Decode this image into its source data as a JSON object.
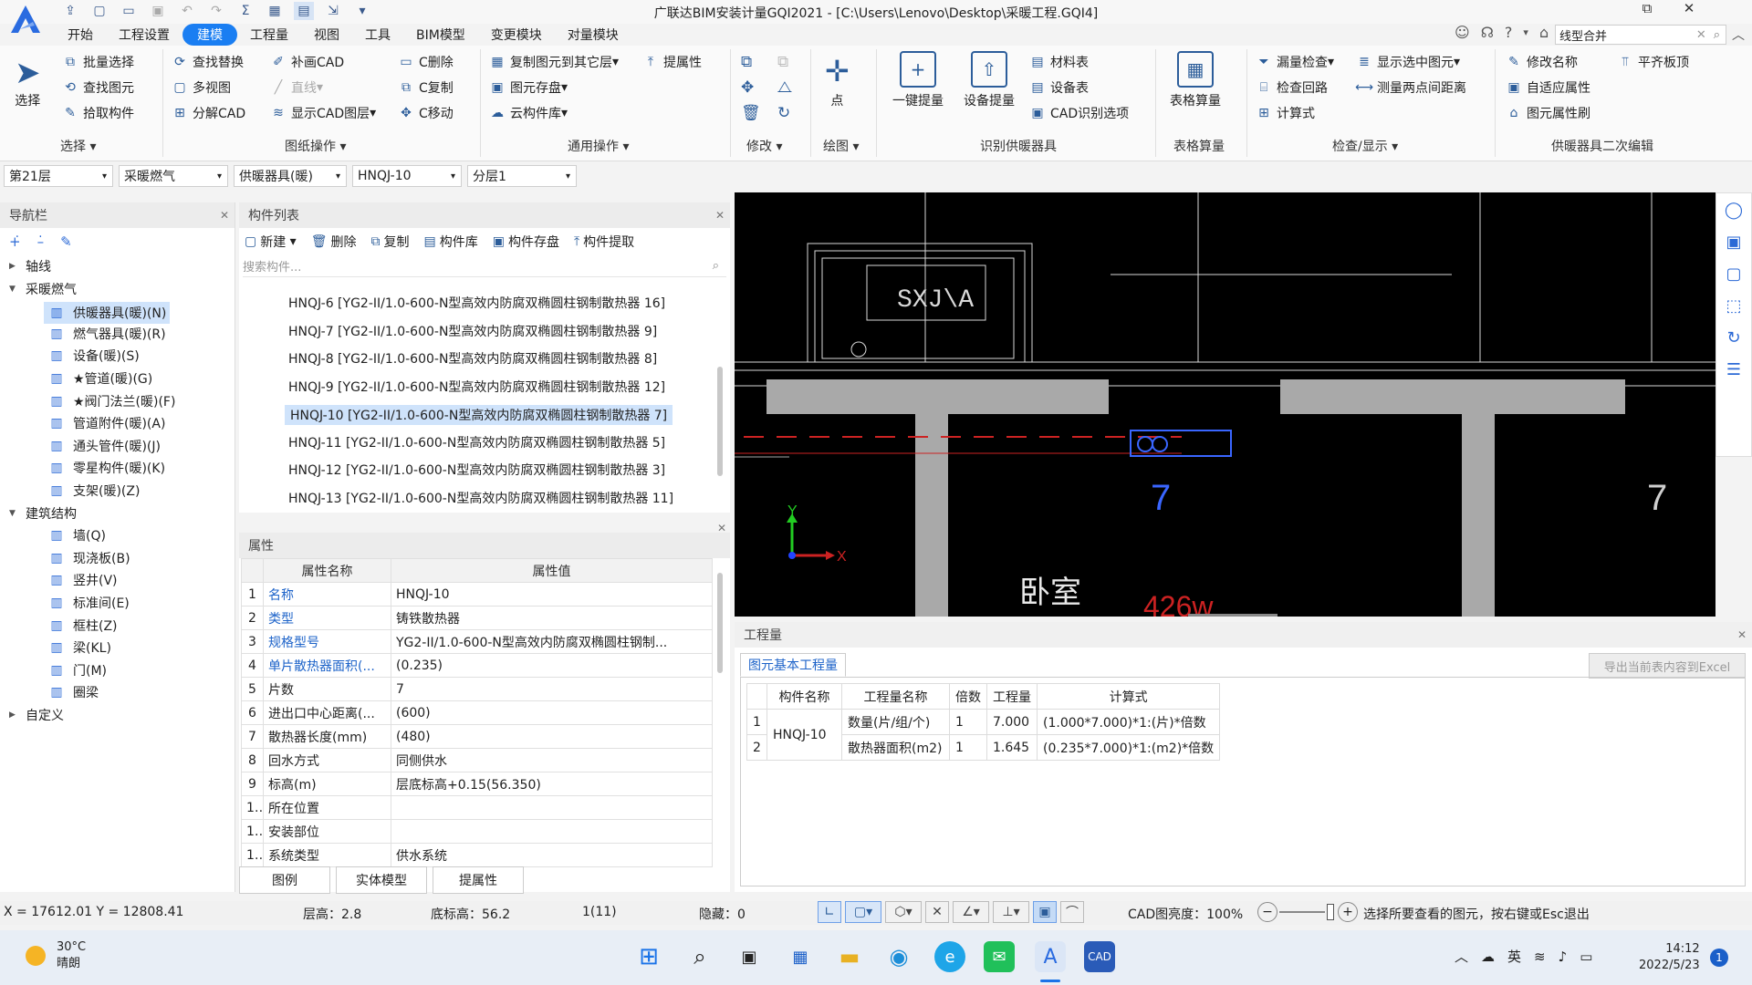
{
  "window": {
    "title": "广联达BIM安装计量GQI2021 - [C:\\Users\\Lenovo\\Desktop\\采暖工程.GQI4]",
    "search_value": "线型合并"
  },
  "menu": [
    "开始",
    "工程设置",
    "建模",
    "工程量",
    "视图",
    "工具",
    "BIM模型",
    "变更模块",
    "对量模块"
  ],
  "ribbon": {
    "select": {
      "big": "选择",
      "items": [
        "批量选择",
        "查找图元",
        "拾取构件"
      ],
      "group": "选择"
    },
    "drawing_ops": {
      "items": [
        "查找替换",
        "多视图",
        "分解CAD",
        "补画CAD",
        "直线",
        "显示CAD图层",
        "C删除",
        "C复制",
        "C移动"
      ],
      "group": "图纸操作"
    },
    "common_ops": {
      "items": [
        "复制图元到其它层",
        "提属性",
        "图元存盘",
        "云构件库"
      ],
      "group": "通用操作"
    },
    "modify": {
      "group": "修改"
    },
    "draw": {
      "big": "点",
      "group": "绘图"
    },
    "identify": {
      "big1": "一键提量",
      "big2": "设备提量",
      "items": [
        "材料表",
        "设备表",
        "CAD识别选项"
      ],
      "group": "识别供暖器具"
    },
    "table": {
      "big": "表格算量",
      "group": "表格算量"
    },
    "check": {
      "items": [
        "漏量检查",
        "显示选中图元",
        "检查回路",
        "测量两点间距离",
        "计算式"
      ],
      "group": "检查/显示"
    },
    "secondary": {
      "items": [
        "修改名称",
        "平齐板顶",
        "自适应属性",
        "图元属性刷"
      ],
      "group": "供暖器具二次编辑"
    }
  },
  "selectors": [
    "第21层",
    "采暖燃气",
    "供暖器具(暖)",
    "HNQJ-10",
    "分层1"
  ],
  "nav": {
    "title": "导航栏",
    "tree": [
      {
        "label": "轴线",
        "level": 0,
        "expanded": false
      },
      {
        "label": "采暖燃气",
        "level": 0,
        "expanded": true
      },
      {
        "label": "供暖器具(暖)(N)",
        "level": 1,
        "icon": "radiator-icon",
        "selected": true
      },
      {
        "label": "燃气器具(暖)(R)",
        "level": 1,
        "icon": "gas-appliance-icon"
      },
      {
        "label": "设备(暖)(S)",
        "level": 1,
        "icon": "equipment-icon"
      },
      {
        "label": "★管道(暖)(G)",
        "level": 1,
        "icon": "pipe-icon"
      },
      {
        "label": "★阀门法兰(暖)(F)",
        "level": 1,
        "icon": "valve-icon"
      },
      {
        "label": "管道附件(暖)(A)",
        "level": 1,
        "icon": "pipe-accessory-icon"
      },
      {
        "label": "通头管件(暖)(J)",
        "level": 1,
        "icon": "fitting-icon"
      },
      {
        "label": "零星构件(暖)(K)",
        "level": 1,
        "icon": "misc-icon"
      },
      {
        "label": "支架(暖)(Z)",
        "level": 1,
        "icon": "bracket-icon"
      },
      {
        "label": "建筑结构",
        "level": 0,
        "expanded": true
      },
      {
        "label": "墙(Q)",
        "level": 1,
        "icon": "wall-icon"
      },
      {
        "label": "现浇板(B)",
        "level": 1,
        "icon": "slab-icon"
      },
      {
        "label": "竖井(V)",
        "level": 1,
        "icon": "shaft-icon"
      },
      {
        "label": "标准间(E)",
        "level": 1,
        "icon": "room-icon"
      },
      {
        "label": "框柱(Z)",
        "level": 1,
        "icon": "column-icon"
      },
      {
        "label": "梁(KL)",
        "level": 1,
        "icon": "beam-icon"
      },
      {
        "label": "门(M)",
        "level": 1,
        "icon": "door-icon"
      },
      {
        "label": "圈梁",
        "level": 1,
        "icon": "ring-beam-icon"
      },
      {
        "label": "自定义",
        "level": 0,
        "expanded": false
      }
    ]
  },
  "component_list": {
    "title": "构件列表",
    "toolbar": [
      "新建",
      "删除",
      "复制",
      "构件库",
      "构件存盘",
      "构件提取"
    ],
    "search_placeholder": "搜索构件...",
    "items": [
      "HNQJ-6 [YG2-II/1.0-600-N型高效内防腐双椭圆柱钢制散热器 16]",
      "HNQJ-7 [YG2-II/1.0-600-N型高效内防腐双椭圆柱钢制散热器 9]",
      "HNQJ-8 [YG2-II/1.0-600-N型高效内防腐双椭圆柱钢制散热器 8]",
      "HNQJ-9 [YG2-II/1.0-600-N型高效内防腐双椭圆柱钢制散热器 12]",
      "HNQJ-10 [YG2-II/1.0-600-N型高效内防腐双椭圆柱钢制散热器 7]",
      "HNQJ-11 [YG2-II/1.0-600-N型高效内防腐双椭圆柱钢制散热器 5]",
      "HNQJ-12 [YG2-II/1.0-600-N型高效内防腐双椭圆柱钢制散热器 3]",
      "HNQJ-13 [YG2-II/1.0-600-N型高效内防腐双椭圆柱钢制散热器 11]"
    ],
    "selected_index": 4
  },
  "properties": {
    "title": "属性",
    "headers": [
      "属性名称",
      "属性值"
    ],
    "rows": [
      {
        "n": "1",
        "name": "名称",
        "value": "HNQJ-10",
        "blue": true
      },
      {
        "n": "2",
        "name": "类型",
        "value": "铸铁散热器",
        "blue": true
      },
      {
        "n": "3",
        "name": "规格型号",
        "value": "YG2-II/1.0-600-N型高效内防腐双椭圆柱钢制...",
        "blue": true
      },
      {
        "n": "4",
        "name": "单片散热器面积(...",
        "value": "(0.235)",
        "blue": true
      },
      {
        "n": "5",
        "name": "片数",
        "value": "7",
        "blue": false
      },
      {
        "n": "6",
        "name": "进出口中心距离(...",
        "value": "(600)",
        "blue": false
      },
      {
        "n": "7",
        "name": "散热器长度(mm)",
        "value": "(480)",
        "blue": false
      },
      {
        "n": "8",
        "name": "回水方式",
        "value": "同侧供水",
        "blue": false
      },
      {
        "n": "9",
        "name": "标高(m)",
        "value": "层底标高+0.15(56.350)",
        "blue": false
      },
      {
        "n": "10",
        "name": "所在位置",
        "value": "",
        "blue": false
      },
      {
        "n": "11",
        "name": "安装部位",
        "value": "",
        "blue": false
      },
      {
        "n": "12",
        "name": "系统类型",
        "value": "供水系统",
        "blue": false
      }
    ],
    "bottom_tabs": [
      "图例",
      "实体模型",
      "提属性"
    ]
  },
  "cad": {
    "room_label": "卧室",
    "count_label": "7",
    "count_label_right": "7",
    "box_text": "SXJ\\A",
    "red_text": "426w"
  },
  "quantities": {
    "title": "工程量",
    "tab": "图元基本工程量",
    "export_button": "导出当前表内容到Excel",
    "headers": [
      "",
      "构件名称",
      "工程量名称",
      "倍数",
      "工程量",
      "计算式"
    ],
    "component": "HNQJ-10",
    "rows": [
      {
        "n": "1",
        "qname": "数量(片/组/个)",
        "mult": "1",
        "qty": "7.000",
        "formula": "(1.000*7.000)*1:(片)*倍数"
      },
      {
        "n": "2",
        "qname": "散热器面积(m2)",
        "mult": "1",
        "qty": "1.645",
        "formula": "(0.235*7.000)*1:(m2)*倍数"
      }
    ]
  },
  "status": {
    "coords": "X = 17612.01 Y = 12808.41",
    "floor_height": "层高：2.8",
    "bottom_elev": "底标高：56.2",
    "count": "1(11)",
    "hidden": "隐藏：0",
    "cad_brightness": "CAD图亮度：100%",
    "hint": "选择所要查看的图元，按右键或Esc退出"
  },
  "taskbar": {
    "weather_temp": "30°C",
    "weather_desc": "晴朗",
    "ime": "英",
    "time": "14:12",
    "date": "2022/5/23",
    "notification_count": "1"
  }
}
